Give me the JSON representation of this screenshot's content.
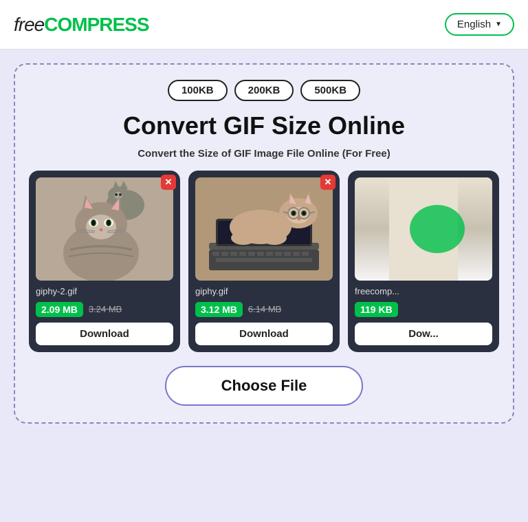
{
  "header": {
    "logo_free": "free",
    "logo_compress": "COMPRESS",
    "language_label": "English",
    "language_arrow": "▼"
  },
  "size_pills": [
    "100KB",
    "200KB",
    "500KB"
  ],
  "main_title": "Convert GIF Size Online",
  "sub_title": "Convert the Size of GIF Image File Online (For Free)",
  "cards": [
    {
      "filename": "giphy-2.gif",
      "size_new": "2.09 MB",
      "size_old": "3.24 MB",
      "download_label": "Download"
    },
    {
      "filename": "giphy.gif",
      "size_new": "3.12 MB",
      "size_old": "6.14 MB",
      "download_label": "Download"
    },
    {
      "filename": "freecomp...",
      "size_new": "119 KB",
      "size_old": "",
      "download_label": "Dow..."
    }
  ],
  "choose_file_label": "Choose File"
}
